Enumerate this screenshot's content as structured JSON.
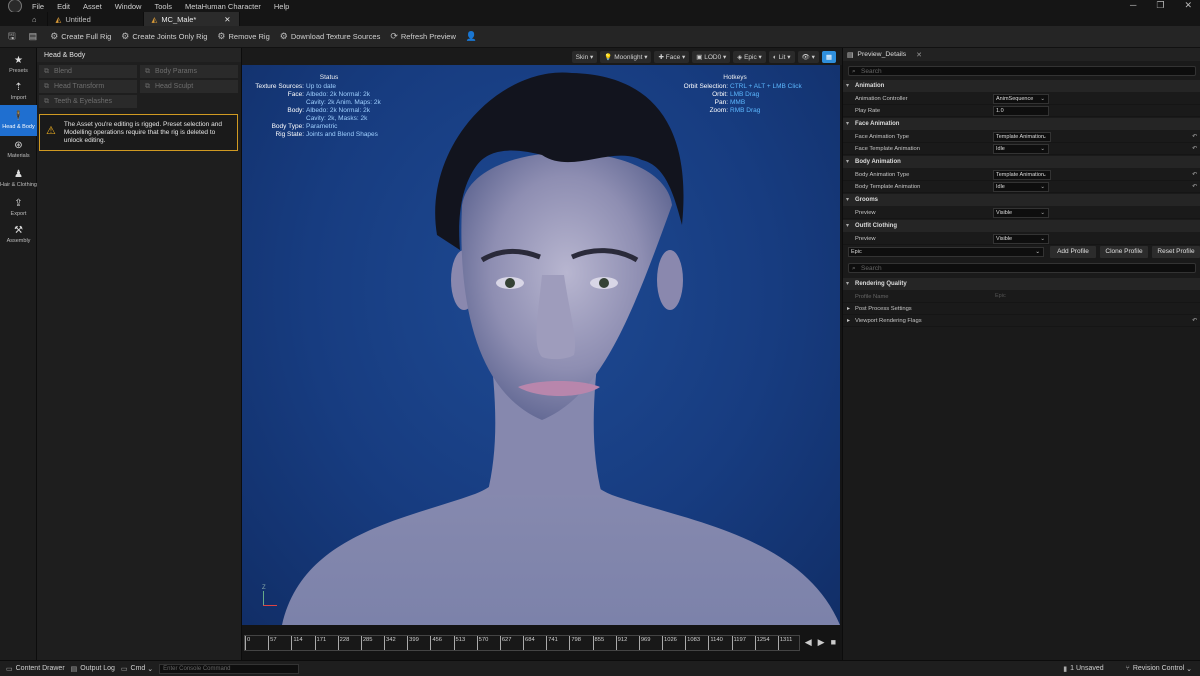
{
  "menubar": {
    "items": [
      "File",
      "Edit",
      "Asset",
      "Window",
      "Tools",
      "MetaHuman Character",
      "Help"
    ]
  },
  "tabs": [
    {
      "label": "Untitled"
    },
    {
      "label": "MC_Male*"
    }
  ],
  "toolbar": {
    "create_full_rig": "Create Full Rig",
    "create_joints_only_rig": "Create Joints Only Rig",
    "remove_rig": "Remove Rig",
    "download_texture_sources": "Download Texture Sources",
    "refresh_preview": "Refresh Preview"
  },
  "rail": {
    "items": [
      {
        "label": "Presets",
        "icon": "star-icon"
      },
      {
        "label": "Import",
        "icon": "import-icon"
      },
      {
        "label": "Head & Body",
        "icon": "person-icon"
      },
      {
        "label": "Materials",
        "icon": "materials-icon"
      },
      {
        "label": "Hair & Clothing",
        "icon": "hair-icon"
      },
      {
        "label": "Export",
        "icon": "export-icon"
      },
      {
        "label": "Assembly",
        "icon": "hammer-icon"
      }
    ]
  },
  "left_panel": {
    "title": "Head & Body",
    "buttons": {
      "blend": "Blend",
      "body_params": "Body Params",
      "head_transform": "Head Transform",
      "head_sculpt": "Head Sculpt",
      "teeth": "Teeth & Eyelashes"
    },
    "warning": "The Asset you're editing is rigged. Preset selection and Modelling operations require that the rig is deleted to unlock editing."
  },
  "viewport_toolbar": {
    "skin": "Skin",
    "lighting": "Moonlight",
    "face": "Face",
    "lod": "LOD0",
    "quality": "Epic",
    "lit": "Lit"
  },
  "status": {
    "title": "Status",
    "rows": [
      [
        "Texture Sources:",
        "Up to date"
      ],
      [
        "Face:",
        "Albedo: 2k Normal: 2k"
      ],
      [
        "",
        "Cavity: 2k Anim. Maps: 2k"
      ],
      [
        "Body:",
        "Albedo: 2k Normal: 2k"
      ],
      [
        "",
        "Cavity: 2k, Masks: 2k"
      ],
      [
        "Body Type:",
        "Parametric"
      ],
      [
        "Rig State:",
        "Joints and Blend Shapes"
      ]
    ]
  },
  "hotkeys": {
    "title": "Hotkeys",
    "rows": [
      [
        "Orbit Selection:",
        "CTRL + ALT + LMB Click"
      ],
      [
        "Orbit:",
        "LMB Drag"
      ],
      [
        "Pan:",
        "MMB"
      ],
      [
        "Zoom:",
        "RMB Drag"
      ]
    ]
  },
  "axes": {
    "z": "Z"
  },
  "timeline": {
    "ticks": [
      "0",
      "57",
      "114",
      "171",
      "228",
      "285",
      "342",
      "399",
      "456",
      "513",
      "570",
      "627",
      "684",
      "741",
      "798",
      "855",
      "912",
      "969",
      "1026",
      "1083",
      "1140",
      "1197",
      "1254",
      "1311"
    ]
  },
  "details": {
    "tab_label": "Preview_Details",
    "search_placeholder": "Search",
    "animation": {
      "title": "Animation",
      "controller_label": "Animation Controller",
      "controller_value": "AnimSequence",
      "play_rate_label": "Play Rate",
      "play_rate_value": "1.0"
    },
    "face_animation": {
      "title": "Face Animation",
      "type_label": "Face Animation Type",
      "type_value": "Template Animation",
      "template_label": "Face Template Animation",
      "template_value": "Idle"
    },
    "body_animation": {
      "title": "Body Animation",
      "type_label": "Body Animation Type",
      "type_value": "Template Animation",
      "template_label": "Body Template Animation",
      "template_value": "Idle"
    },
    "grooms": {
      "title": "Grooms",
      "preview_label": "Preview",
      "preview_value": "Visible"
    },
    "outfit": {
      "title": "Outfit Clothing",
      "preview_label": "Preview",
      "preview_value": "Visible"
    },
    "profile": {
      "value": "Epic",
      "add": "Add Profile",
      "clone": "Clone Profile",
      "reset": "Reset Profile"
    },
    "search2_placeholder": "Search",
    "rendering": {
      "title": "Rendering Quality",
      "profile_name_label": "Profile Name",
      "profile_name_value": "Epic",
      "post_process": "Post Process Settings",
      "viewport_flags": "Viewport Rendering Flags"
    }
  },
  "bottombar": {
    "content_drawer": "Content Drawer",
    "output_log": "Output Log",
    "cmd": "Cmd",
    "console_placeholder": "Enter Console Command",
    "unsaved": "1 Unsaved",
    "revision_control": "Revision Control"
  }
}
